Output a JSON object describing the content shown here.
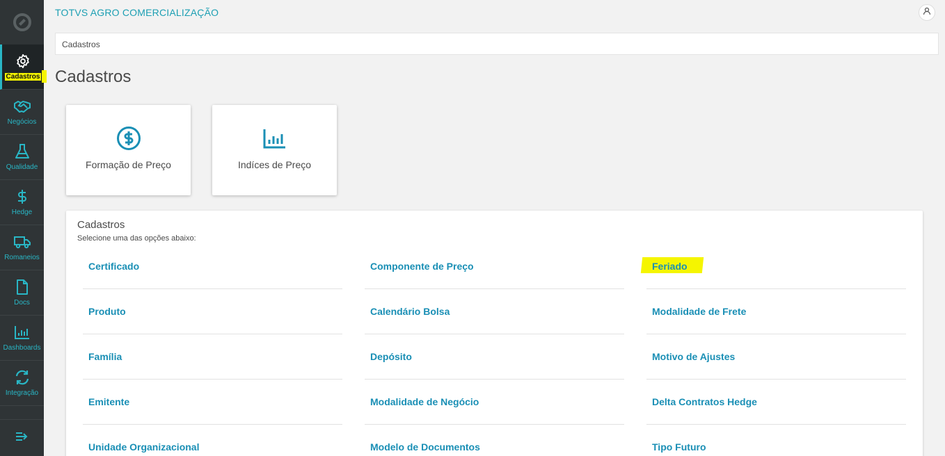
{
  "app": {
    "title": "TOTVS AGRO COMERCIALIZAÇÃO"
  },
  "breadcrumb": "Cadastros",
  "page_title": "Cadastros",
  "sidebar": {
    "items": [
      {
        "label": "Cadastros",
        "icon": "gear-icon",
        "active": true
      },
      {
        "label": "Negócios",
        "icon": "handshake-icon"
      },
      {
        "label": "Qualidade",
        "icon": "flask-icon"
      },
      {
        "label": "Hedge",
        "icon": "dollar-sign-icon"
      },
      {
        "label": "Romaneios",
        "icon": "truck-icon"
      },
      {
        "label": "Docs",
        "icon": "document-icon"
      },
      {
        "label": "Dashboards",
        "icon": "bar-chart-icon"
      },
      {
        "label": "Integração",
        "icon": "sync-icon"
      }
    ]
  },
  "cards": [
    {
      "label": "Formação de Preço",
      "icon": "dollar-circle-icon"
    },
    {
      "label": "Indíces de Preço",
      "icon": "bar-chart-icon"
    }
  ],
  "panel": {
    "title": "Cadastros",
    "subtitle": "Selecione uma das opções abaixo:",
    "columns": [
      [
        "Certificado",
        "Produto",
        "Família",
        "Emitente",
        "Unidade Organizacional"
      ],
      [
        "Componente de Preço",
        "Calendário Bolsa",
        "Depósito",
        "Modalidade de Negócio",
        "Modelo de Documentos"
      ],
      [
        "Feriado",
        "Modalidade de Frete",
        "Motivo de Ajustes",
        "Delta Contratos Hedge",
        "Tipo Futuro"
      ]
    ]
  },
  "colors": {
    "accent": "#1a8fb5",
    "sidebar": "#2f3436",
    "highlight": "#f5f500"
  }
}
